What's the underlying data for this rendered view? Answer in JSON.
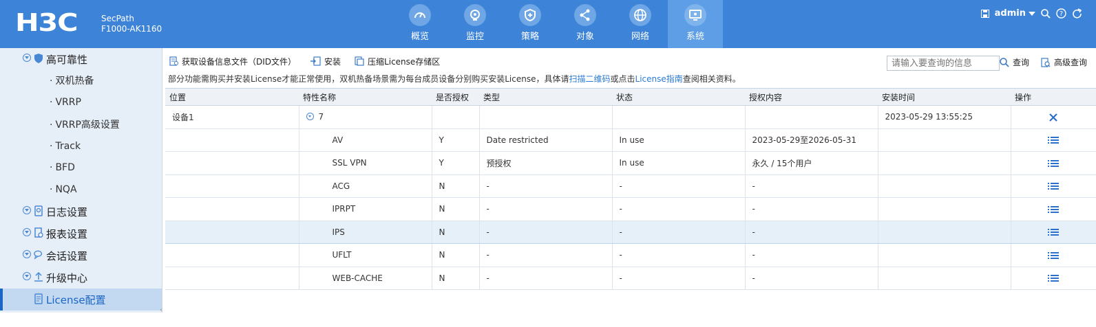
{
  "brand": {
    "logo": "H3C",
    "product_line1": "SecPath",
    "product_line2": "F1000-AK1160"
  },
  "nav": [
    {
      "label": "概览",
      "icon": "dashboard-icon",
      "active": false
    },
    {
      "label": "监控",
      "icon": "camera-icon",
      "active": false
    },
    {
      "label": "策略",
      "icon": "shield-icon",
      "active": false
    },
    {
      "label": "对象",
      "icon": "share-icon",
      "active": false
    },
    {
      "label": "网络",
      "icon": "globe-icon",
      "active": false
    },
    {
      "label": "系统",
      "icon": "monitor-icon",
      "active": true
    }
  ],
  "user": {
    "name": "admin"
  },
  "sidebar": {
    "items": [
      {
        "label": "高可靠性",
        "type": "group"
      },
      {
        "label": "双机热备",
        "type": "sub"
      },
      {
        "label": "VRRP",
        "type": "sub"
      },
      {
        "label": "VRRP高级设置",
        "type": "sub"
      },
      {
        "label": "Track",
        "type": "sub"
      },
      {
        "label": "BFD",
        "type": "sub"
      },
      {
        "label": "NQA",
        "type": "sub"
      },
      {
        "label": "日志设置",
        "type": "group"
      },
      {
        "label": "报表设置",
        "type": "group"
      },
      {
        "label": "会话设置",
        "type": "group"
      },
      {
        "label": "升级中心",
        "type": "group"
      },
      {
        "label": "License配置",
        "type": "selected"
      }
    ]
  },
  "toolbar": {
    "get_did": "获取设备信息文件（DID文件）",
    "install": "安装",
    "compress": "压缩License存储区",
    "search_placeholder": "请输入要查询的信息",
    "search": "查询",
    "advanced": "高级查询"
  },
  "tip": {
    "text1": "部分功能需购买并安装License才能正常使用，双机热备场景需为每台成员设备分别购买安装License，具体请",
    "link1": "扫描二维码",
    "text2": "或点击",
    "link2": "License指南",
    "text3": "查阅相关资料。"
  },
  "table": {
    "columns": [
      "位置",
      "特性名称",
      "是否授权",
      "类型",
      "状态",
      "授权内容",
      "安装时间",
      "操作"
    ],
    "group_row": {
      "location": "设备1",
      "name": "7",
      "install_time": "2023-05-29 13:55:25"
    },
    "rows": [
      {
        "name": "AV",
        "authorized": "Y",
        "type": "Date restricted",
        "status": "In use",
        "content": "2023-05-29至2026-05-31"
      },
      {
        "name": "SSL VPN",
        "authorized": "Y",
        "type": "预授权",
        "status": "In use",
        "content": "永久 / 15个用户"
      },
      {
        "name": "ACG",
        "authorized": "N",
        "type": "-",
        "status": "-",
        "content": "-"
      },
      {
        "name": "IPRPT",
        "authorized": "N",
        "type": "-",
        "status": "-",
        "content": "-"
      },
      {
        "name": "IPS",
        "authorized": "N",
        "type": "-",
        "status": "-",
        "content": "-"
      },
      {
        "name": "UFLT",
        "authorized": "N",
        "type": "-",
        "status": "-",
        "content": "-"
      },
      {
        "name": "WEB-CACHE",
        "authorized": "N",
        "type": "-",
        "status": "-",
        "content": "-"
      }
    ]
  },
  "colors": {
    "header_bg": "#3d84d8",
    "nav_active": "#5d9ee6",
    "sidebar_bg": "#e6eef8",
    "link": "#2a7bd6",
    "row_highlight": "#e6f0f9"
  }
}
